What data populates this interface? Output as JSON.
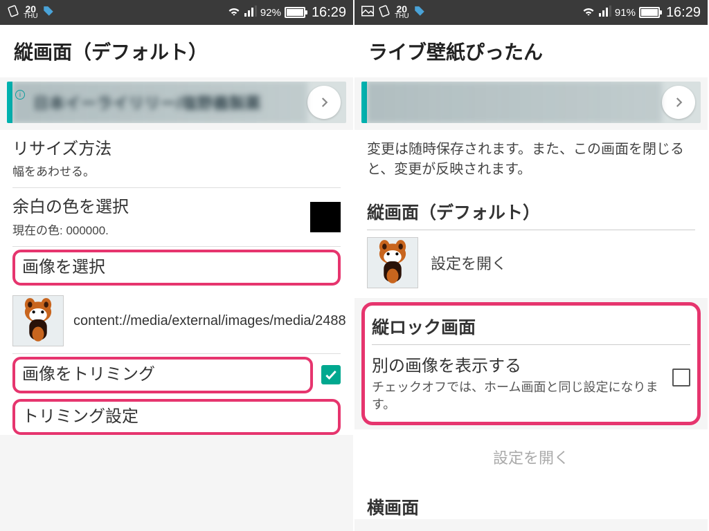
{
  "left": {
    "status": {
      "date_num": "20",
      "date_day": "THU",
      "battery_pct": "92%",
      "time": "16:29"
    },
    "title": "縦画面（デフォルト）",
    "ad_text": "日本イーライリリー/塩野義製薬",
    "resize_title": "リサイズ方法",
    "resize_sub": "幅をあわせる。",
    "margin_title": "余白の色を選択",
    "margin_sub": "現在の色: 000000.",
    "select_image": "画像を選択",
    "image_uri": "content://media/external/images/media/2488",
    "crop_image": "画像をトリミング",
    "crop_settings": "トリミング設定"
  },
  "right": {
    "status": {
      "date_num": "20",
      "date_day": "THU",
      "battery_pct": "91%",
      "time": "16:29"
    },
    "title": "ライブ壁紙ぴったん",
    "help": "変更は随時保存されます。また、この画面を閉じると、変更が反映されます。",
    "portrait_header": "縦画面（デフォルト）",
    "open_settings": "設定を開く",
    "lock_header": "縦ロック画面",
    "lock_title": "別の画像を表示する",
    "lock_sub": "チェックオフでは、ホーム画面と同じ設定になります。",
    "disabled_open": "設定を開く",
    "landscape_header": "横画面"
  }
}
